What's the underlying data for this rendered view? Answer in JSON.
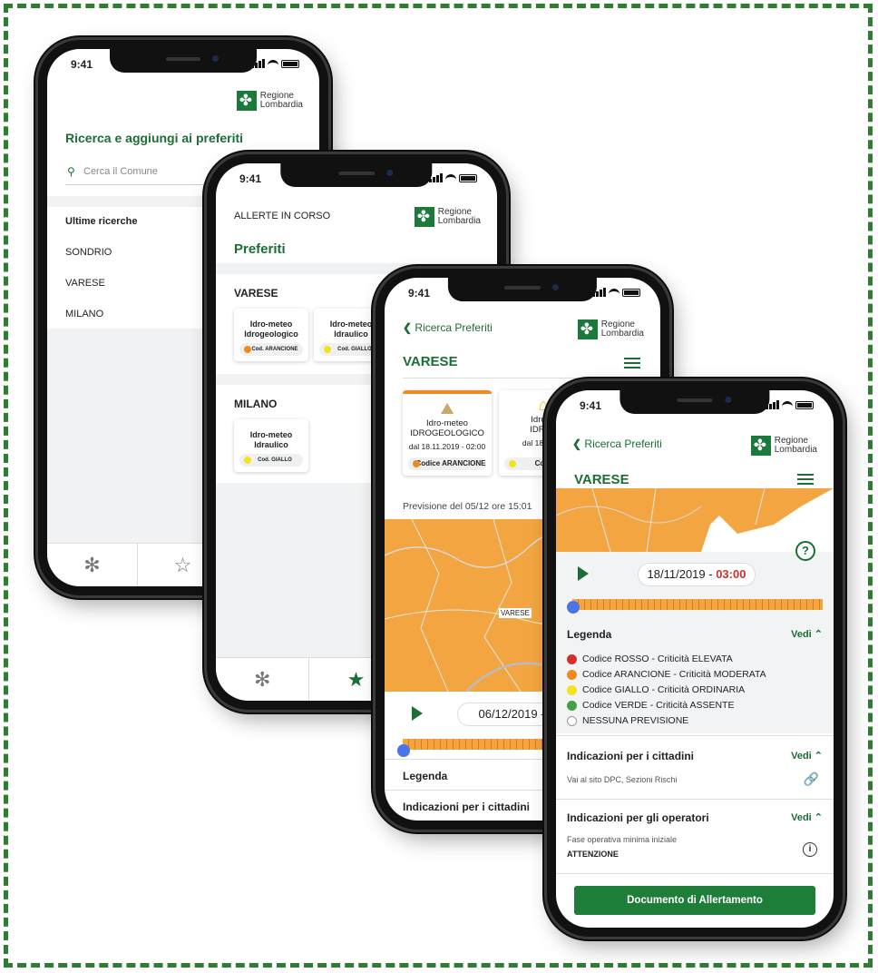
{
  "status": {
    "time": "9:41"
  },
  "brand": {
    "line1": "Regione",
    "line2": "Lombardia"
  },
  "screen1": {
    "title": "Ricerca e aggiungi ai preferiti",
    "search_placeholder": "Cerca il Comune",
    "recent_title": "Ultime ricerche",
    "recent": [
      "SONDRIO",
      "VARESE",
      "MILANO"
    ]
  },
  "screen2": {
    "top": "ALLERTE IN CORSO",
    "title": "Preferiti",
    "group1": "VARESE",
    "group2": "MILANO",
    "cards_varese": [
      {
        "title1": "Idro-meteo",
        "title2": "Idrogeologico",
        "code": "Cod. ARANCIONE",
        "color": "#ef8a1f"
      },
      {
        "title1": "Idro-meteo",
        "title2": "Idraulico",
        "code": "Cod. GIALLO",
        "color": "#f4e21c"
      }
    ],
    "cards_milano": [
      {
        "title1": "Idro-meteo",
        "title2": "Idraulico",
        "code": "Cod. GIALLO",
        "color": "#f4e21c"
      }
    ]
  },
  "screen3": {
    "back": "Ricerca Preferiti",
    "title": "VARESE",
    "card1": {
      "title1": "Idro-meteo",
      "title2": "IDROGEOLOGICO",
      "date": "dal 18.11.2019 - 02:00",
      "code": "Codice ARANCIONE"
    },
    "card2": {
      "title1": "Idro-m",
      "title2": "IDRAU",
      "date": "dal 18.11.20",
      "code": "Codice"
    },
    "forecast": "Previsione del 05/12 ore 15:01",
    "map_label": "VARESE",
    "date": "06/12/2019 - ",
    "legend": "Legenda",
    "indications": "Indicazioni per i cittadini"
  },
  "screen4": {
    "back": "Ricerca Preferiti",
    "title": "VARESE",
    "date": "18/11/2019 - ",
    "time": "03:00",
    "legend_title": "Legenda",
    "vedi": "Vedi",
    "legend": [
      {
        "label": "Codice ROSSO - Criticità ELEVATA",
        "color": "#d32f2f"
      },
      {
        "label": "Codice ARANCIONE - Criticità MODERATA",
        "color": "#ef8a1f"
      },
      {
        "label": "Codice GIALLO - Criticità ORDINARIA",
        "color": "#f4e21c"
      },
      {
        "label": "Codice VERDE - Criticità ASSENTE",
        "color": "#43a047"
      },
      {
        "label": "NESSUNA PREVISIONE",
        "color": "#ffffff"
      }
    ],
    "cit_title": "Indicazioni per i cittadini",
    "cit_link": "Vai al sito DPC, Sezioni Rischi",
    "op_title": "Indicazioni per gli operatori",
    "op_sub": "Fase operativa minima iniziale",
    "op_value": "ATTENZIONE",
    "doc_button": "Documento di Allertamento"
  }
}
